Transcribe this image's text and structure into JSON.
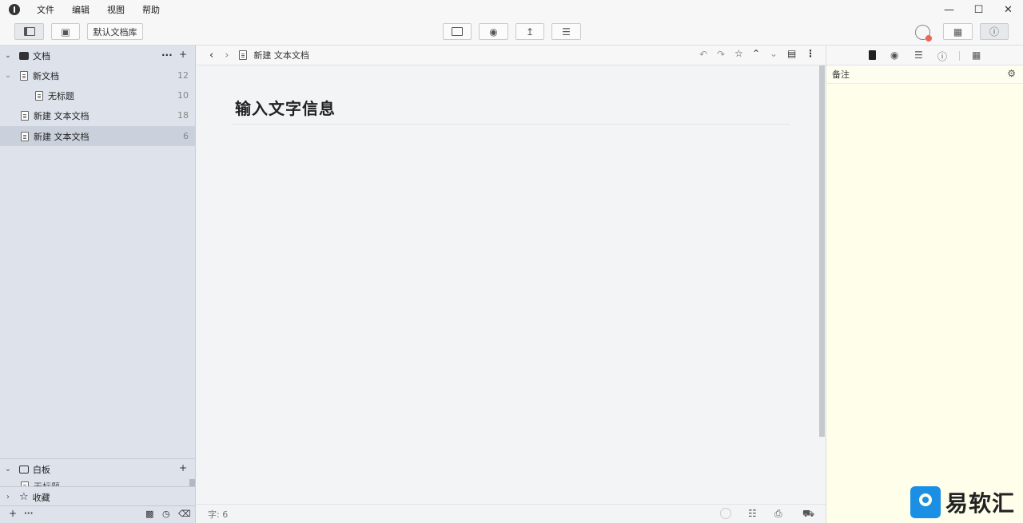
{
  "menu": [
    "文件",
    "编辑",
    "视图",
    "帮助"
  ],
  "window_controls": [
    "minimize-icon",
    "maximize-icon",
    "close-icon"
  ],
  "toolbar": {
    "library_label": "默认文档库"
  },
  "sidebar": {
    "docs_section_label": "文档",
    "docs_more": "···",
    "docs_add": "+",
    "tree": [
      {
        "label": "新文档",
        "count": "12",
        "level": 0,
        "expanded": true
      },
      {
        "label": "无标题",
        "count": "10",
        "level": 1
      },
      {
        "label": "新建 文本文档",
        "count": "18",
        "level": 0
      },
      {
        "label": "新建 文本文档",
        "count": "6",
        "level": 0,
        "selected": true
      }
    ],
    "whiteboard_label": "白板",
    "whiteboard_add": "+",
    "whiteboard_child_partial": "无标题",
    "favorites_label": "收藏",
    "footer_add": "+",
    "footer_more": "···"
  },
  "editor": {
    "breadcrumb": "新建 文本文档",
    "title": "输入文字信息",
    "word_count": "字: 6"
  },
  "right_panel": {
    "notes_label": "备注"
  },
  "watermark": {
    "text": "易软汇"
  },
  "colors": {
    "sidebar_bg": "#dde2eb",
    "sidebar_selected": "#cbd1dc",
    "editor_bg": "#f3f4f6",
    "notes_bg": "#fefeeb",
    "watermark_blue": "#1a8fe3"
  }
}
